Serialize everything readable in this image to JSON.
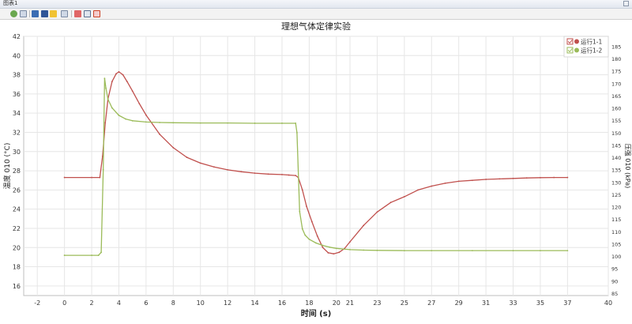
{
  "window": {
    "title": "图表1"
  },
  "toolbar": {
    "icons": [
      "back-icon",
      "refresh-icon",
      "zoom-icon",
      "chart-type-icon",
      "monitor-icon",
      "cursor-icon",
      "export-icon",
      "grid-icon",
      "table-icon",
      "settings-icon"
    ]
  },
  "colors": {
    "series1": "#c0504d",
    "series2": "#9bbb59",
    "grid": "#e6e6e6",
    "axis": "#555555"
  },
  "chart_data": {
    "type": "line",
    "title": "理想气体定律实验",
    "xlabel": "时间 (s)",
    "ylabel_left": "温度 010 (°C)",
    "ylabel_right": "压强 010 (kPa)",
    "xlim": [
      -3,
      40
    ],
    "xticks": [
      -2,
      0,
      2,
      4,
      6,
      8,
      10,
      12,
      14,
      16,
      18,
      20,
      21,
      23,
      25,
      27,
      29,
      31,
      33,
      35,
      37,
      40
    ],
    "ylim_left": [
      15,
      42
    ],
    "yticks_left": [
      16,
      18,
      20,
      22,
      24,
      26,
      28,
      30,
      32,
      34,
      36,
      38,
      40,
      42
    ],
    "ylim_right": [
      84,
      189
    ],
    "yticks_right": [
      85,
      90,
      95,
      100,
      105,
      110,
      115,
      120,
      125,
      130,
      135,
      140,
      145,
      150,
      155,
      160,
      165,
      170,
      175,
      180,
      185
    ],
    "grid": true,
    "legend_position": "top-right",
    "series": [
      {
        "name": "运行1-1",
        "axis": "left",
        "x": [
          0,
          2,
          2.6,
          2.8,
          3.0,
          3.2,
          3.5,
          3.8,
          4.0,
          4.3,
          4.6,
          5.0,
          5.5,
          6,
          7,
          8,
          9,
          10,
          11,
          12,
          13,
          14,
          15,
          16,
          16.5,
          17.0,
          17.2,
          17.5,
          17.8,
          18.2,
          18.6,
          19.0,
          19.4,
          19.8,
          20.2,
          20.6,
          21,
          22,
          23,
          24,
          25,
          26,
          27,
          28,
          29,
          30,
          31,
          32,
          33,
          34,
          35,
          36,
          37
        ],
        "values": [
          27.3,
          27.3,
          27.3,
          29.5,
          33.0,
          35.5,
          37.3,
          38.1,
          38.3,
          38.0,
          37.3,
          36.3,
          35.0,
          33.8,
          31.8,
          30.4,
          29.4,
          28.8,
          28.4,
          28.1,
          27.9,
          27.75,
          27.65,
          27.6,
          27.55,
          27.5,
          27.3,
          26.0,
          24.3,
          22.7,
          21.2,
          20.0,
          19.45,
          19.35,
          19.5,
          19.9,
          20.6,
          22.3,
          23.7,
          24.7,
          25.3,
          26.0,
          26.4,
          26.7,
          26.9,
          27.0,
          27.1,
          27.15,
          27.2,
          27.25,
          27.28,
          27.3,
          27.3
        ]
      },
      {
        "name": "运行1-2",
        "axis": "right",
        "x": [
          0,
          2,
          2.5,
          2.7,
          2.85,
          2.95,
          3.05,
          3.2,
          3.5,
          4.0,
          4.5,
          5.0,
          6,
          7,
          8,
          10,
          12,
          14,
          16,
          17.0,
          17.1,
          17.3,
          17.5,
          17.7,
          18.0,
          18.5,
          19.0,
          19.5,
          20,
          21,
          22,
          23,
          25,
          27,
          30,
          33,
          35,
          37
        ],
        "values": [
          100.3,
          100.3,
          100.3,
          101.5,
          135.0,
          172.0,
          168.0,
          163.5,
          160.0,
          157.0,
          155.5,
          154.8,
          154.3,
          154.1,
          154.0,
          153.9,
          153.9,
          153.8,
          153.8,
          153.8,
          150.0,
          118.0,
          111.0,
          108.5,
          106.8,
          105.3,
          104.3,
          103.6,
          103.1,
          102.6,
          102.4,
          102.3,
          102.2,
          102.2,
          102.2,
          102.2,
          102.2,
          102.2
        ]
      }
    ]
  }
}
